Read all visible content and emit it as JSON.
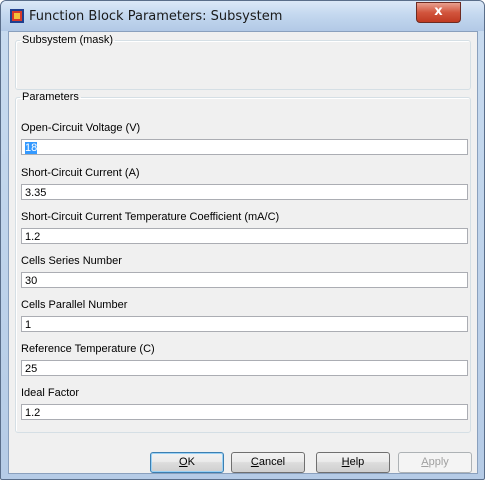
{
  "window": {
    "title": "Function Block Parameters: Subsystem",
    "close_glyph": "x"
  },
  "mask_group": {
    "legend": "Subsystem (mask)"
  },
  "params_group": {
    "legend": "Parameters"
  },
  "parameters": [
    {
      "label": "Open-Circuit Voltage (V)",
      "value": "18",
      "selected": true
    },
    {
      "label": "Short-Circuit Current (A)",
      "value": "3.35"
    },
    {
      "label": "Short-Circuit Current Temperature Coefficient (mA/C)",
      "value": "1.2"
    },
    {
      "label": "Cells Series Number",
      "value": "30"
    },
    {
      "label": "Cells Parallel Number",
      "value": "1"
    },
    {
      "label": "Reference Temperature (C)",
      "value": "25"
    },
    {
      "label": "Ideal Factor",
      "value": "1.2"
    }
  ],
  "buttons": {
    "ok": {
      "mnemonic": "O",
      "rest": "K"
    },
    "cancel": {
      "mnemonic": "C",
      "rest": "ancel"
    },
    "help": {
      "mnemonic": "H",
      "rest": "elp"
    },
    "apply": {
      "mnemonic": "A",
      "rest": "pply",
      "enabled": false
    }
  },
  "colors": {
    "selection": "#3399ff",
    "close_button": "#c03a22",
    "dialog_background": "#f0f0f0"
  }
}
